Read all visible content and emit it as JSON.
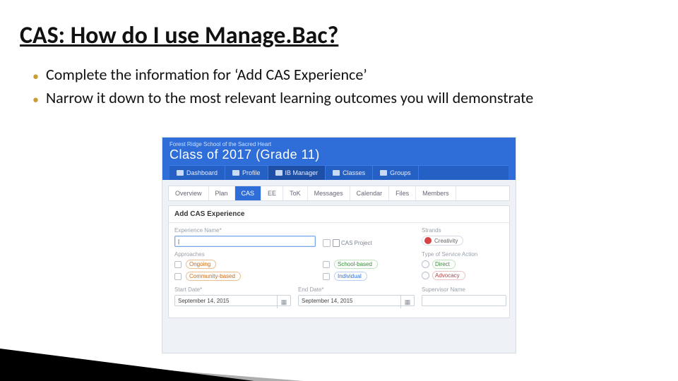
{
  "slide": {
    "title": "CAS: How do I use Manage.Bac?",
    "bullets": [
      "Complete the information for ‘Add CAS Experience’",
      "Narrow it down to the most relevant learning outcomes you will demonstrate"
    ]
  },
  "app": {
    "school": "Forest Ridge School of the Sacred Heart",
    "classline": "Class of 2017 (Grade 11)",
    "primary_nav": [
      "Dashboard",
      "Profile",
      "IB Manager",
      "Classes",
      "Groups"
    ],
    "primary_nav_active": 2,
    "subnav": [
      "Overview",
      "Plan",
      "CAS",
      "EE",
      "ToK",
      "Messages",
      "Calendar",
      "Files",
      "Members"
    ],
    "subnav_active": 2,
    "panel_title": "Add CAS Experience",
    "labels": {
      "experience_name": "Experience Name*",
      "cas_project": "CAS Project",
      "strands_header": "Strands",
      "strand_creativity": "Creativity",
      "approaches_header": "Approaches",
      "type_header": "Type of Service Action",
      "direct": "Direct",
      "advocacy": "Advocacy",
      "start_date": "Start Date*",
      "end_date": "End Date*",
      "supervisor": "Supervisor Name"
    },
    "approach_pills": {
      "ongoing": "Ongoing",
      "community": "Community-based",
      "school": "School-based",
      "individual": "Individual"
    },
    "dates": {
      "start": "September 14, 2015",
      "end": "September 14, 2015"
    }
  }
}
